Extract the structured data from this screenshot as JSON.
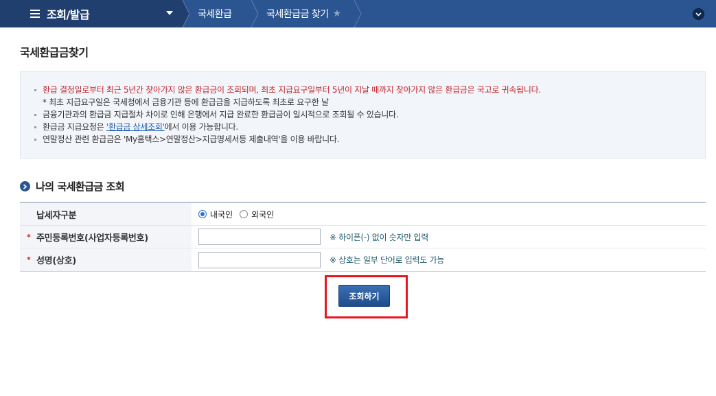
{
  "nav": {
    "menu_title": "조회/발급",
    "breadcrumbs": [
      "국세환급",
      "국세환급금 찾기"
    ]
  },
  "page": {
    "title": "국세환급금찾기"
  },
  "notice": {
    "item1": "환급 결정일로부터 최근 5년간 찾아가지 않은 환급금이 조회되며, 최초 지급요구일부터 5년이 지날 때까지 찾아가지 않은 환급금은 국고로 귀속됩니다.",
    "item1_sub": "* 최초 지급요구일은 국세청에서 금융기관 등에 환급금을 지급하도록 최초로 요구한 날",
    "item2": "금융기관과의 환급금 지급절차 차이로 인해 은행에서 지급 완료한 환급금이 일시적으로 조회될 수 있습니다.",
    "item3_prefix": "환급금 지급요청은 ",
    "item3_link": "'환급금 상세조회'",
    "item3_suffix": "에서 이용 가능합니다.",
    "item4": "연말정산 관련 환급금은 'My홈택스>연말정산>지급명세서등 제출내역'을 이용 바랍니다."
  },
  "section": {
    "title": "나의 국세환급금 조회"
  },
  "form": {
    "taxpayer_type_label": "납세자구분",
    "radio_domestic": "내국인",
    "radio_foreign": "외국인",
    "selected": "내국인",
    "id_label": "주민등록번호(사업자등록번호)",
    "id_value": "",
    "id_hint": "※ 하이픈(-) 없이 숫자만 입력",
    "name_label": "성명(상호)",
    "name_value": "",
    "name_hint": "※ 상호는 일부 단어로 입력도 가능",
    "required_mark": "*"
  },
  "actions": {
    "search_label": "조회하기"
  },
  "colors": {
    "nav_bg": "#2b5591",
    "menu_bg": "#203f6f",
    "warning_text": "#c0282d",
    "highlight": "#e8141e"
  },
  "icons": {
    "menu": "hamburger-icon",
    "dropdown": "caret-down-icon",
    "favorite": "star-icon",
    "expand": "chevron-down-circle-icon",
    "section": "arrow-right-circle-icon"
  }
}
